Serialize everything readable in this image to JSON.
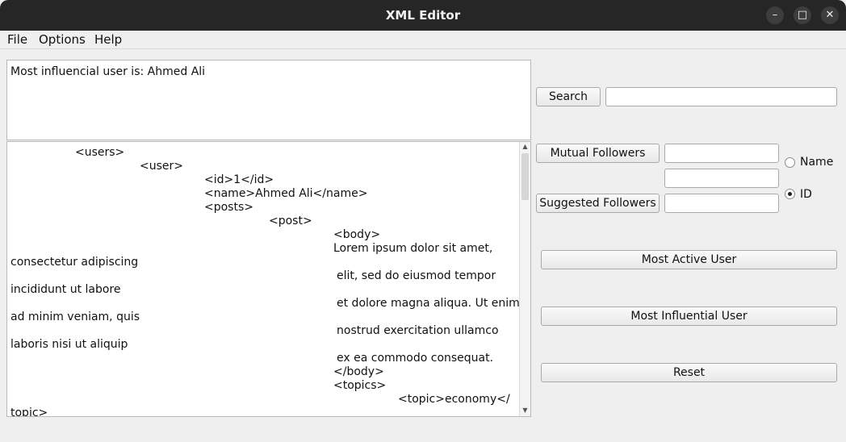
{
  "window": {
    "title": "XML Editor",
    "minimize_glyph": "–",
    "maximize_glyph": "□",
    "close_glyph": "✕"
  },
  "menu": {
    "file": "File",
    "options": "Options",
    "help": "Help"
  },
  "output": {
    "text": "Most influencial user is: Ahmed Ali"
  },
  "editor": {
    "lines": [
      "<users>",
      "<user>",
      "<id>1</id>",
      "<name>Ahmed Ali</name>",
      "<posts>",
      "<post>",
      "<body>",
      "Lorem ipsum dolor sit amet,",
      "consectetur adipiscing",
      "elit, sed do eiusmod tempor",
      "incididunt ut labore",
      "et dolore magna aliqua. Ut enim",
      "ad minim veniam, quis",
      "nostrud exercitation ullamco",
      "laboris nisi ut aliquip",
      "ex ea commodo consequat.",
      "</body>",
      "<topics>",
      "<topic>economy</",
      "topic>"
    ]
  },
  "controls": {
    "search_label": "Search",
    "search_value": "",
    "mutual_followers_label": "Mutual Followers",
    "mutual_field_1": "",
    "mutual_field_2": "",
    "suggested_followers_label": "Suggested Followers",
    "suggested_field": "",
    "radio_name_label": "Name",
    "radio_id_label": "ID",
    "radio_selected": "ID",
    "most_active_label": "Most Active User",
    "most_influential_label": "Most Influential User",
    "reset_label": "Reset"
  }
}
